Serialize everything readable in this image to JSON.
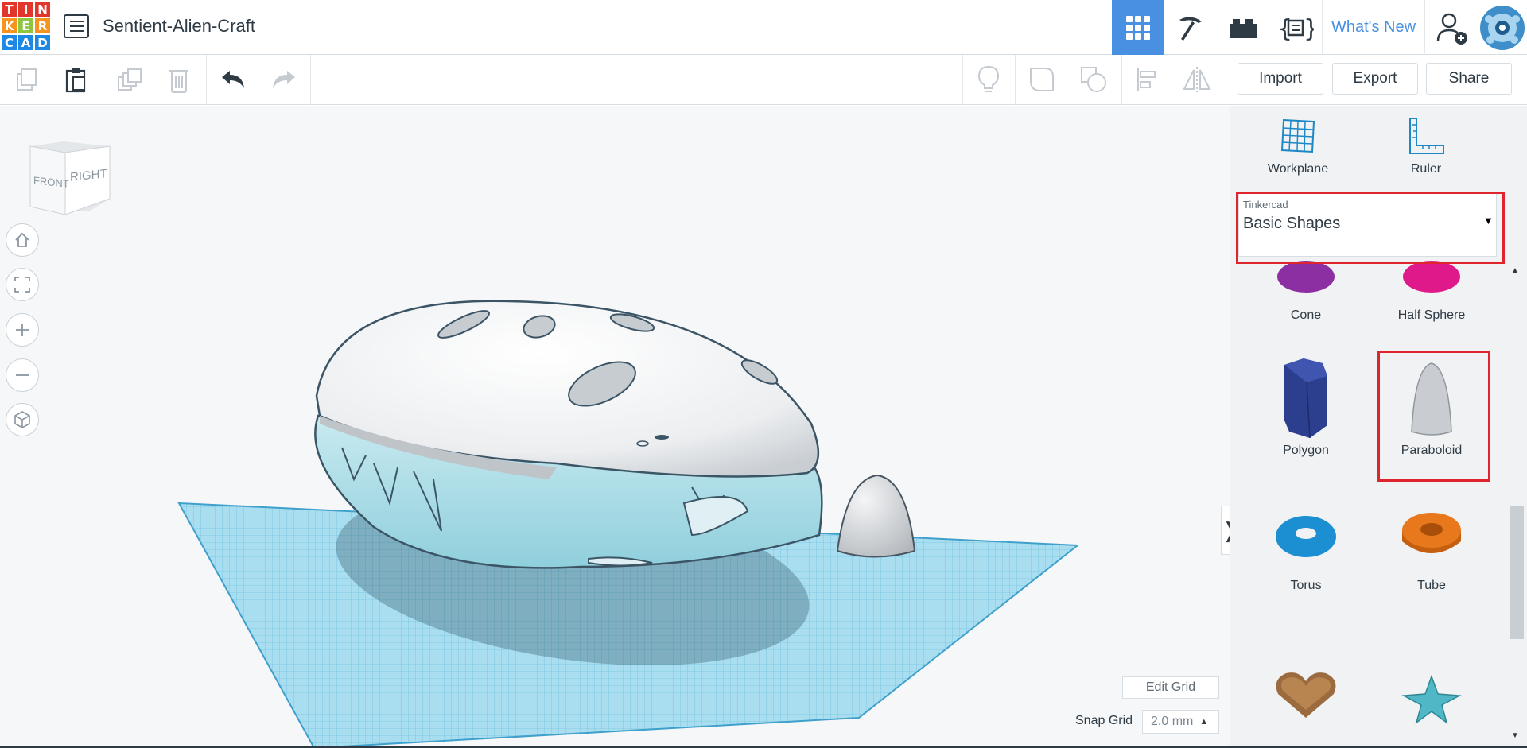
{
  "app": {
    "logo_letters": [
      "T",
      "I",
      "N",
      "K",
      "E",
      "R",
      "C",
      "A",
      "D"
    ],
    "logo_colors": [
      "#e2352b",
      "#e2352b",
      "#e2352b",
      "#f7941d",
      "#f7941d",
      "#8dc63f",
      "#1e88e5",
      "#1e88e5",
      "#1e88e5"
    ],
    "document_title": "Sentient-Alien-Craft"
  },
  "topnav": {
    "items": [
      {
        "name": "3d-design-view",
        "icon": "grid-icon",
        "active": true
      },
      {
        "name": "circuits",
        "icon": "pickaxe-icon",
        "active": false
      },
      {
        "name": "bricks",
        "icon": "bricks-icon",
        "active": false
      },
      {
        "name": "codeblocks",
        "icon": "codeblocks-icon",
        "active": false
      }
    ],
    "whats_new": "What's New",
    "add_user_icon": "add-user-icon",
    "avatar_icon": "avatar-icon"
  },
  "toolbar": {
    "left": [
      "copy-icon",
      "paste-icon",
      "duplicate-icon",
      "delete-icon",
      "undo-icon",
      "redo-icon"
    ],
    "right": [
      "lightbulb-icon",
      "group-icon",
      "ungroup-icon",
      "align-icon",
      "mirror-icon"
    ],
    "import_label": "Import",
    "export_label": "Export",
    "share_label": "Share"
  },
  "viewcube": {
    "front": "FRONT",
    "right": "RIGHT"
  },
  "view_controls": [
    "home-view-icon",
    "fit-view-icon",
    "zoom-in-icon",
    "zoom-out-icon",
    "perspective-icon"
  ],
  "workspace": {
    "edit_grid_label": "Edit Grid",
    "snap_grid_label": "Snap Grid",
    "snap_grid_value": "2.0 mm"
  },
  "panel": {
    "workplane_label": "Workplane",
    "ruler_label": "Ruler",
    "library_small": "Tinkercad",
    "library_name": "Basic Shapes",
    "shapes": [
      {
        "label": "Cone",
        "color": "#8b2fa3"
      },
      {
        "label": "Half Sphere",
        "color": "#e0198a"
      },
      {
        "label": "Polygon",
        "color": "#2c3f8f"
      },
      {
        "label": "Paraboloid",
        "color": "#c9cdd1"
      },
      {
        "label": "Torus",
        "color": "#1b8fd1"
      },
      {
        "label": "Tube",
        "color": "#e8781c"
      },
      {
        "label": "",
        "color": "#9b6a3f"
      },
      {
        "label": "",
        "color": "#4fb7c5"
      }
    ]
  }
}
